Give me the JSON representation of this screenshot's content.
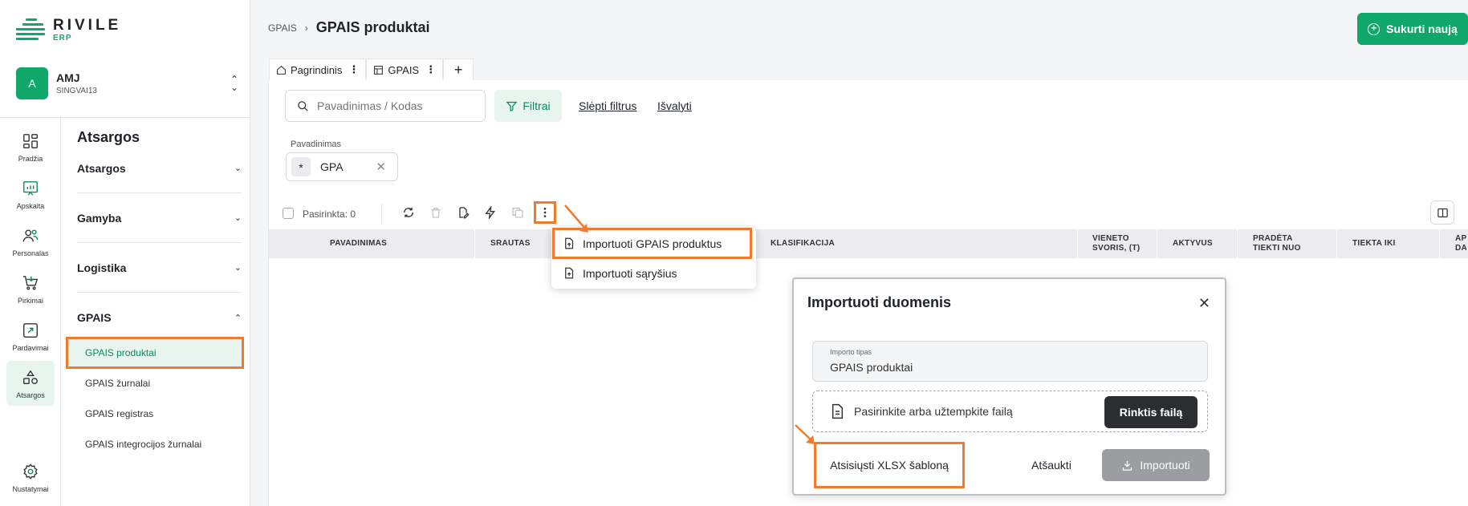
{
  "brand": {
    "name": "RIVILE",
    "sub": "ERP",
    "color": "#0fa86a"
  },
  "company": {
    "initial": "A",
    "name": "AMJ",
    "code": "SINGVAI13"
  },
  "rail": [
    {
      "label": "Pradžia",
      "icon": "dashboard-icon"
    },
    {
      "label": "Apskaita",
      "icon": "chart-board-icon"
    },
    {
      "label": "Personalas",
      "icon": "people-icon"
    },
    {
      "label": "Pirkimai",
      "icon": "cart-icon"
    },
    {
      "label": "Pardavimai",
      "icon": "sales-icon"
    },
    {
      "label": "Atsargos",
      "icon": "shapes-icon",
      "active": true
    },
    {
      "label": "Nustatymai",
      "icon": "gear-icon"
    }
  ],
  "nav": {
    "title": "Atsargos",
    "groups": [
      {
        "label": "Atsargos"
      },
      {
        "label": "Gamyba"
      },
      {
        "label": "Logistika"
      },
      {
        "label": "GPAIS",
        "expanded": true
      }
    ],
    "items": [
      {
        "label": "GPAIS produktai",
        "active": true
      },
      {
        "label": "GPAIS žurnalai"
      },
      {
        "label": "GPAIS registras"
      },
      {
        "label": "GPAIS integrocijos žurnalai"
      }
    ]
  },
  "header": {
    "breadcrumb_root": "GPAIS",
    "title": "GPAIS produktai",
    "new_button": "Sukurti naują"
  },
  "tabs": [
    {
      "label": "Pagrindinis",
      "icon": "home-icon"
    },
    {
      "label": "GPAIS",
      "icon": "table-icon"
    }
  ],
  "filters": {
    "search_placeholder": "Pavadinimas / Kodas",
    "filter_button": "Filtrai",
    "hide_filters": "Slėpti filtrus",
    "clear": "Išvalyti",
    "active_filter": {
      "label": "Pavadinimas",
      "operator": "*",
      "value": "GPA"
    }
  },
  "toolbar": {
    "selected": "Pasirinkta: 0"
  },
  "table": {
    "columns": [
      "PAVADINIMAS",
      "SRAUTAS",
      "KLASIFIKACIJA",
      "VIENETO SVORIS, (T)",
      "AKTYVUS",
      "PRADĖTA TIEKTI NUO",
      "TIEKTA IKI",
      "AP DA"
    ]
  },
  "menu": {
    "items": [
      "Importuoti GPAIS produktus",
      "Importuoti sąryšius"
    ]
  },
  "dialog": {
    "title": "Importuoti duomenis",
    "type_label": "Importo tipas",
    "type_value": "GPAIS produktai",
    "dropzone_text": "Pasirinkite arba užtempkite failą",
    "choose_button": "Rinktis failą",
    "download_template": "Atsisiųsti XLSX šabloną",
    "cancel": "Atšaukti",
    "import": "Importuoti"
  },
  "colors": {
    "accent": "#0fa86a",
    "highlight": "#f07b2e",
    "active_bg": "#e7f5ee"
  }
}
